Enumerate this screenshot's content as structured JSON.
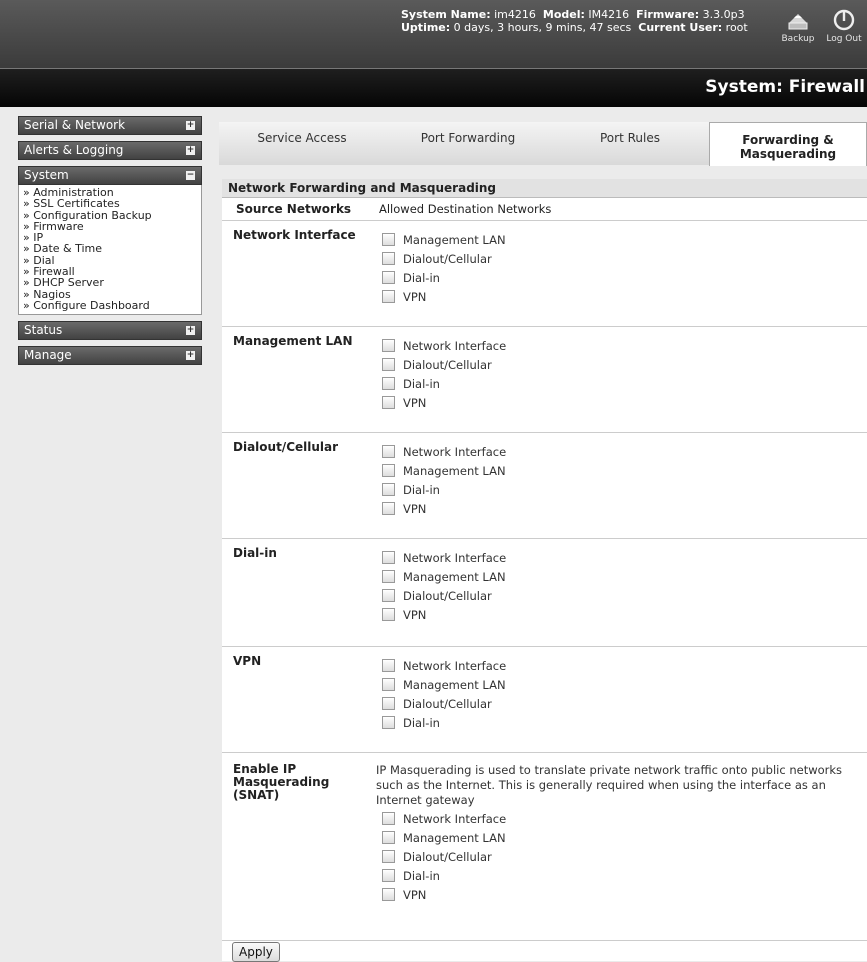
{
  "header": {
    "system_name_label": "System Name:",
    "system_name": "im4216",
    "model_label": "Model:",
    "model": "IM4216",
    "firmware_label": "Firmware:",
    "firmware": "3.3.0p3",
    "uptime_label": "Uptime:",
    "uptime": "0 days, 3 hours, 9 mins, 47 secs",
    "current_user_label": "Current User:",
    "current_user": "root",
    "backup_label": "Backup",
    "logout_label": "Log Out",
    "backup_icon": "backup-icon",
    "logout_icon": "power-icon"
  },
  "page_title": "System: Firewall",
  "sidebar": {
    "sections": [
      {
        "label": "Serial & Network",
        "toggle": "+"
      },
      {
        "label": "Alerts & Logging",
        "toggle": "+"
      },
      {
        "label": "System",
        "toggle": "−"
      },
      {
        "label": "Status",
        "toggle": "+"
      },
      {
        "label": "Manage",
        "toggle": "+"
      }
    ],
    "system_items": [
      "» Administration",
      "» SSL Certificates",
      "» Configuration Backup",
      "» Firmware",
      "» IP",
      "» Date & Time",
      "» Dial",
      "» Firewall",
      "» DHCP Server",
      "» Nagios",
      "» Configure Dashboard"
    ]
  },
  "tabs": [
    {
      "label": "Service Access",
      "active": false
    },
    {
      "label": "Port Forwarding",
      "active": false
    },
    {
      "label": "Port Rules",
      "active": false
    },
    {
      "label": "Forwarding & Masquerading",
      "label_line1": "Forwarding &",
      "label_line2": "Masquerading",
      "active": true
    }
  ],
  "main": {
    "section_title": "Network Forwarding and Masquerading",
    "col_source": "Source Networks",
    "col_dest": "Allowed Destination Networks",
    "rows": [
      {
        "label": "Network Interface",
        "options": [
          "Management LAN",
          "Dialout/Cellular",
          "Dial-in",
          "VPN"
        ]
      },
      {
        "label": "Management LAN",
        "options": [
          "Network Interface",
          "Dialout/Cellular",
          "Dial-in",
          "VPN"
        ]
      },
      {
        "label": "Dialout/Cellular",
        "options": [
          "Network Interface",
          "Management LAN",
          "Dial-in",
          "VPN"
        ]
      },
      {
        "label": "Dial-in",
        "options": [
          "Network Interface",
          "Management LAN",
          "Dialout/Cellular",
          "VPN"
        ]
      },
      {
        "label": "VPN",
        "options": [
          "Network Interface",
          "Management LAN",
          "Dialout/Cellular",
          "Dial-in"
        ]
      }
    ],
    "masq": {
      "label_line1": "Enable IP",
      "label_line2": "Masquerading",
      "label_line3": "(SNAT)",
      "description": "IP Masquerading is used to translate private network traffic onto public networks such as the Internet. This is generally required when using the interface as an Internet gateway",
      "options": [
        "Network Interface",
        "Management LAN",
        "Dialout/Cellular",
        "Dial-in",
        "VPN"
      ]
    },
    "apply_label": "Apply"
  }
}
